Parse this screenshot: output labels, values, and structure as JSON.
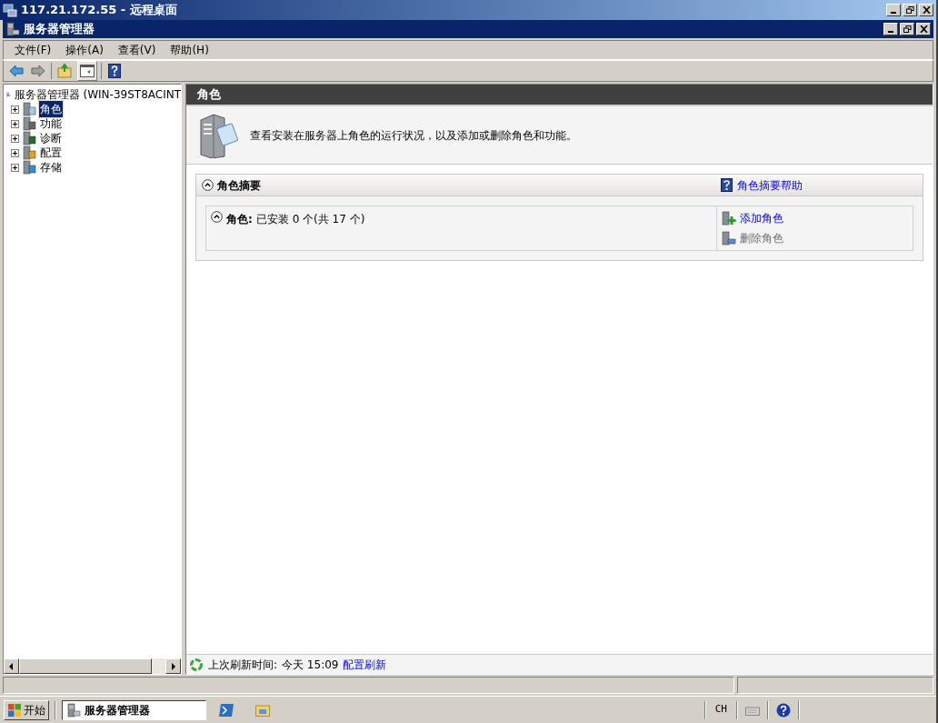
{
  "remote_window": {
    "title": "117.21.172.55 - 远程桌面"
  },
  "app_window": {
    "title": "服务器管理器"
  },
  "menu": [
    {
      "label": "文件(F)"
    },
    {
      "label": "操作(A)"
    },
    {
      "label": "查看(V)"
    },
    {
      "label": "帮助(H)"
    }
  ],
  "tree": {
    "root": "服务器管理器 (WIN-39ST8ACINT",
    "children": [
      {
        "label": "角色",
        "selected": true,
        "expanded": false
      },
      {
        "label": "功能",
        "selected": false,
        "expanded": false
      },
      {
        "label": "诊断",
        "selected": false,
        "expanded": false
      },
      {
        "label": "配置",
        "selected": false,
        "expanded": false
      },
      {
        "label": "存储",
        "selected": false,
        "expanded": false
      }
    ]
  },
  "pane": {
    "header": "角色",
    "description": "查看安装在服务器上角色的运行状况，以及添加或删除角色和功能。",
    "section": {
      "title": "角色摘要",
      "expanded": true,
      "help_link": "角色摘要帮助",
      "subsection": {
        "label": "角色:",
        "value": "已安装 0 个(共 17 个)",
        "expanded": true
      },
      "actions": [
        {
          "label": "添加角色",
          "disabled": false
        },
        {
          "label": "删除角色",
          "disabled": true
        }
      ]
    },
    "footer": {
      "label": "上次刷新时间:",
      "value": "今天 15:09",
      "link": "配置刷新"
    }
  },
  "taskbar": {
    "start": "开始",
    "tasks": [
      {
        "label": "服务器管理器",
        "selected": true
      }
    ],
    "language": "CH"
  }
}
